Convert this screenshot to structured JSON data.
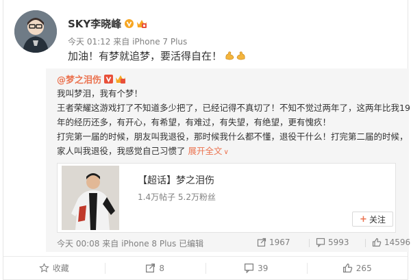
{
  "post": {
    "author_name": "SKY李晓峰",
    "meta_time": "今天 01:12",
    "meta_source_prefix": "来自",
    "meta_source": "iPhone 7 Plus",
    "text": "加油！有梦就追梦，要活得自在！",
    "emoji": "muscle-emoji"
  },
  "repost": {
    "author_name": "@梦之泪伤",
    "lines": [
      "我叫梦泪，我有个梦！",
      "王者荣耀这游戏打了不知道多少把了，已经记得不真切了！不知不觉过两年了，这两年比我19",
      "年的经历还多，有开心，有希望，有难过，有失望，有绝望，更有愧疚！",
      "打完第一届的时候，朋友叫我退役，那时候我什么都不懂，退役干什么！打完第二届的时候，",
      "家人叫我退役，我感觉自己习惯了"
    ],
    "expand_label": "展开全文",
    "expand_arrow": "∨",
    "link_card": {
      "title": "【超话】梦之泪伤",
      "subtitle": "1.4万帖子 5.2万粉丝",
      "follow_plus": "+",
      "follow_label": "关注"
    },
    "meta_time": "今天 00:08",
    "meta_source_prefix": "来自",
    "meta_source": "iPhone 8 Plus",
    "meta_edited": "已编辑",
    "reposts": "1967",
    "comments": "5993",
    "likes": "14596"
  },
  "actions": {
    "favorite_label": "收藏",
    "repost_count": "8",
    "comment_count": "39",
    "like_count": "265"
  },
  "colors": {
    "accent": "#eb7350",
    "verified": "#f6a623",
    "meta_gray": "#808080",
    "repost_bg": "#f5f5f5"
  }
}
